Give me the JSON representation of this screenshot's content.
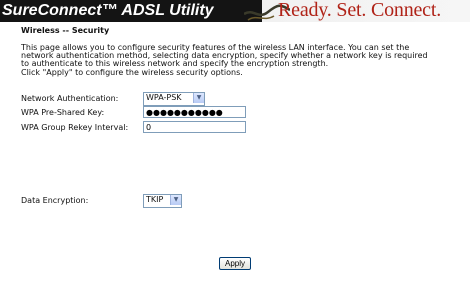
{
  "banner": {
    "brand": "SureConnect™ ADSL Utility",
    "slogan": "Ready. Set. Connect."
  },
  "page": {
    "title": "Wireless -- Security",
    "description": [
      "This page allows you to configure security features of the wireless LAN interface. You can set the",
      "network authentication method, selecting data encryption, specify whether a network key is required",
      "to authenticate to this wireless network and specify the encryption strength.",
      "Click \"Apply\" to configure the wireless security options."
    ]
  },
  "form": {
    "auth_label": "Network Authentication:",
    "auth_value": "WPA-PSK",
    "psk_label": "WPA Pre-Shared Key:",
    "psk_value": "●●●●●●●●●●●",
    "rekey_label": "WPA Group Rekey Interval:",
    "rekey_value": "0",
    "encryption_label": "Data Encryption:",
    "encryption_value": "TKIP",
    "apply_label": "Apply"
  },
  "icons": {
    "dropdown": "chevron-down-icon"
  },
  "colors": {
    "slogan": "#b02318",
    "banner_dark": "#141414"
  }
}
